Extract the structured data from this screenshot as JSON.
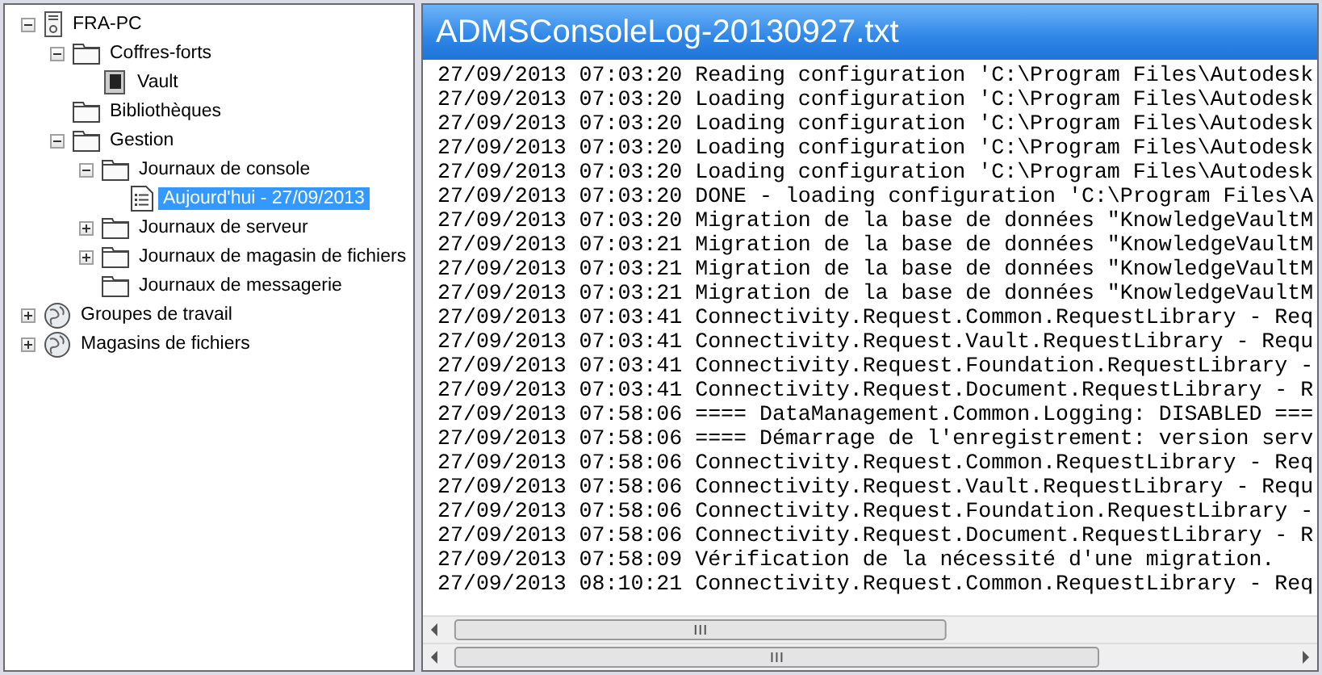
{
  "tree": [
    {
      "label": "FRA-PC",
      "kind": "computer",
      "expanded": true,
      "selected": false,
      "children": [
        {
          "label": "Coffres-forts",
          "kind": "folder",
          "expanded": true,
          "selected": false,
          "children": [
            {
              "label": "Vault",
              "kind": "vault",
              "selected": false
            }
          ]
        },
        {
          "label": "Bibliothèques",
          "kind": "folder",
          "selected": false
        },
        {
          "label": "Gestion",
          "kind": "folder",
          "expanded": true,
          "selected": false,
          "children": [
            {
              "label": "Journaux de console",
              "kind": "folder",
              "expanded": true,
              "selected": false,
              "children": [
                {
                  "label": "Aujourd'hui - 27/09/2013",
                  "kind": "log",
                  "selected": true
                }
              ]
            },
            {
              "label": "Journaux de serveur",
              "kind": "folder",
              "expanded": false,
              "selected": false
            },
            {
              "label": "Journaux de magasin de fichiers",
              "kind": "folder",
              "expanded": false,
              "selected": false
            },
            {
              "label": "Journaux de messagerie",
              "kind": "folder",
              "selected": false
            }
          ]
        }
      ]
    },
    {
      "label": "Groupes de travail",
      "kind": "globe",
      "expanded": false,
      "selected": false
    },
    {
      "label": "Magasins de fichiers",
      "kind": "globe",
      "expanded": false,
      "selected": false
    }
  ],
  "document": {
    "title": "ADMSConsoleLog-20130927.txt",
    "lines": [
      "27/09/2013 07:03:20 Reading configuration 'C:\\Program Files\\Autodesk",
      "27/09/2013 07:03:20 Loading configuration 'C:\\Program Files\\Autodesk",
      "27/09/2013 07:03:20 Loading configuration 'C:\\Program Files\\Autodesk",
      "27/09/2013 07:03:20 Loading configuration 'C:\\Program Files\\Autodesk",
      "27/09/2013 07:03:20 Loading configuration 'C:\\Program Files\\Autodesk",
      "27/09/2013 07:03:20 DONE - loading configuration 'C:\\Program Files\\A",
      "27/09/2013 07:03:20 Migration de la base de données \"KnowledgeVaultM",
      "27/09/2013 07:03:21 Migration de la base de données \"KnowledgeVaultM",
      "27/09/2013 07:03:21 Migration de la base de données \"KnowledgeVaultM",
      "27/09/2013 07:03:21 Migration de la base de données \"KnowledgeVaultM",
      "27/09/2013 07:03:41 Connectivity.Request.Common.RequestLibrary - Req",
      "27/09/2013 07:03:41 Connectivity.Request.Vault.RequestLibrary - Requ",
      "27/09/2013 07:03:41 Connectivity.Request.Foundation.RequestLibrary -",
      "27/09/2013 07:03:41 Connectivity.Request.Document.RequestLibrary - R",
      "27/09/2013 07:58:06 ==== DataManagement.Common.Logging: DISABLED ===",
      "27/09/2013 07:58:06 ==== Démarrage de l'enregistrement: version serv",
      "27/09/2013 07:58:06 Connectivity.Request.Common.RequestLibrary - Req",
      "27/09/2013 07:58:06 Connectivity.Request.Vault.RequestLibrary - Requ",
      "27/09/2013 07:58:06 Connectivity.Request.Foundation.RequestLibrary -",
      "27/09/2013 07:58:06 Connectivity.Request.Document.RequestLibrary - R",
      "27/09/2013 07:58:09 Vérification de la nécessité d'une migration.",
      "27/09/2013 08:10:21 Connectivity.Request.Common.RequestLibrary - Req"
    ]
  }
}
